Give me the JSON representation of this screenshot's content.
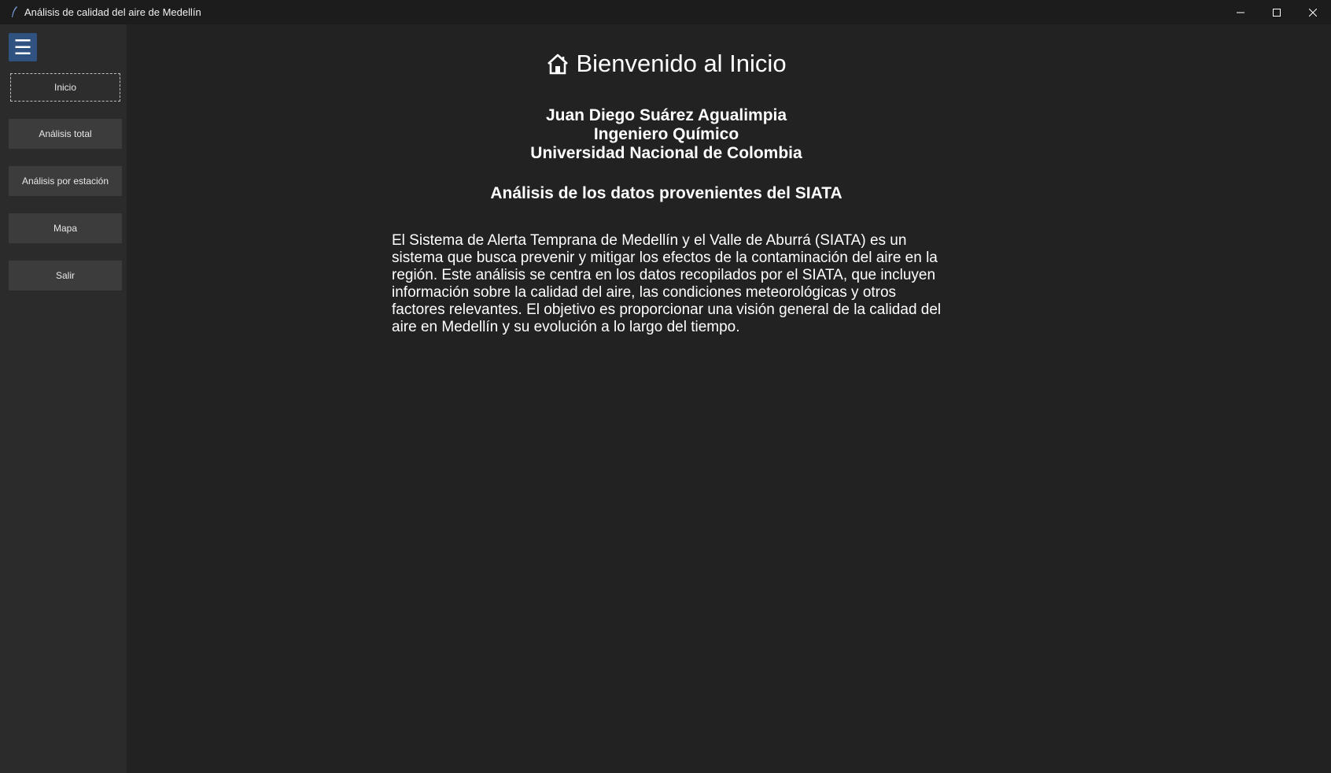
{
  "window": {
    "title": "Análisis de calidad del aire de Medellín"
  },
  "sidebar": {
    "toggle_icon": "hamburger-menu-icon",
    "items": [
      {
        "label": "Inicio",
        "active": true
      },
      {
        "label": "Análisis total",
        "active": false
      },
      {
        "label": "Análisis por estación",
        "active": false
      },
      {
        "label": "Mapa",
        "active": false
      },
      {
        "label": "Salir",
        "active": false
      }
    ]
  },
  "main": {
    "heading": "Bienvenido al Inicio",
    "heading_icon": "home-icon",
    "author": {
      "name": "Juan Diego Suárez Agualimpia",
      "role": "Ingeniero Químico",
      "institution": "Universidad Nacional de Colombia"
    },
    "subtitle": "Análisis de los datos provenientes del SIATA",
    "description": "El Sistema de Alerta Temprana de Medellín y el Valle de Aburrá (SIATA) es un sistema que busca prevenir y mitigar los efectos de la contaminación del aire en la región. Este análisis se centra en los datos recopilados por el SIATA, que incluyen información sobre la calidad del aire, las condiciones meteorológicas y otros factores relevantes. El objetivo es proporcionar una visión general de la calidad del aire en Medellín y su evolución a lo largo del tiempo."
  },
  "colors": {
    "window_bg": "#222222",
    "sidebar_bg": "#2b2b2b",
    "nav_button_bg": "#3c3c3c",
    "accent": "#2f5281"
  }
}
